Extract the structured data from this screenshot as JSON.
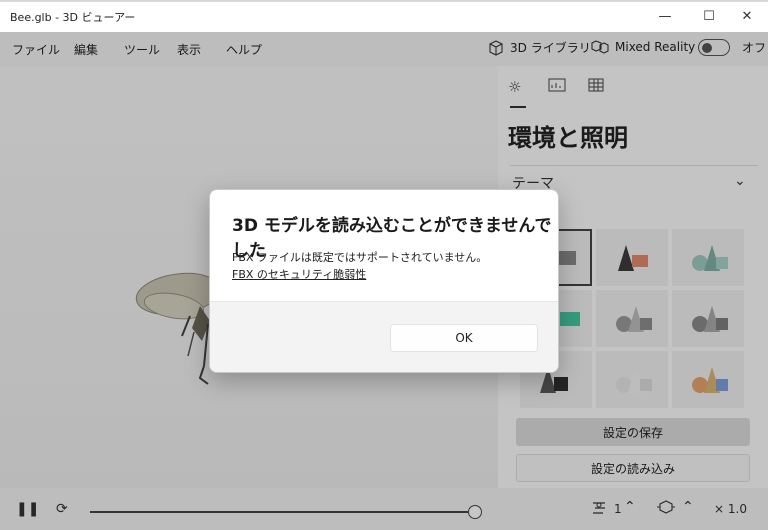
{
  "window": {
    "title": "Bee.glb - 3D ビューアー",
    "minimize_icon": "minimize-icon",
    "maximize_icon": "maximize-icon",
    "close_icon": "close-icon"
  },
  "menubar": {
    "items": [
      "ファイル",
      "編集",
      "ツール",
      "表示",
      "ヘルプ"
    ],
    "library_label": "3D ライブラリ",
    "mixed_reality_label": "Mixed Reality",
    "toggle_state_label": "オフ"
  },
  "panel": {
    "tabs": [
      "lighting-icon",
      "stats-icon",
      "grid-icon"
    ],
    "heading": "環境と照明",
    "section_title": "テーマ",
    "save_label": "設定の保存",
    "load_label": "設定の読み込み"
  },
  "bottombar": {
    "animation_speed": "1",
    "zoom_label": "× 1.0"
  },
  "dialog": {
    "title": "3D モデルを読み込むことができませんでした",
    "message": "FBX ファイルは既定ではサポートされていません。",
    "link": "FBX のセキュリティ脆弱性",
    "ok_label": "OK"
  }
}
